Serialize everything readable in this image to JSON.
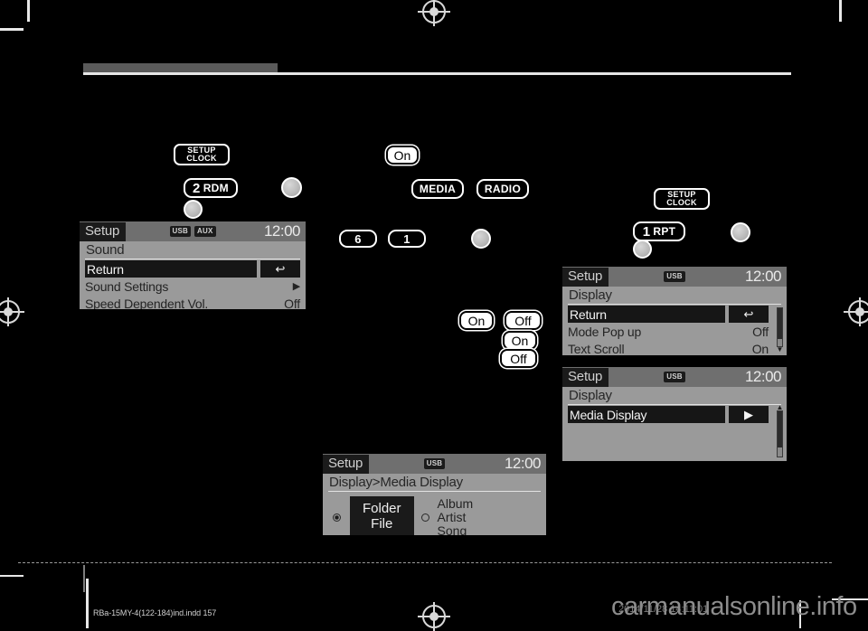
{
  "page": {
    "footer_file": "RBa-15MY-4(122-184)ind.indd   157",
    "watermark": "carmanualsonline.info",
    "watermark_time": "2014/11/28   14:11:01"
  },
  "keys": {
    "setup_clock_left": {
      "line1": "SETUP",
      "line2": "CLOCK"
    },
    "setup_clock_right": {
      "line1": "SETUP",
      "line2": "CLOCK"
    },
    "preset_2_rdm": {
      "digit": "2",
      "word": "RDM"
    },
    "preset_1_rpt": {
      "digit": "1",
      "word": "RPT"
    },
    "media": "MEDIA",
    "radio": "RADIO",
    "preset_6": "6",
    "preset_1": "1"
  },
  "softkeys": {
    "on_top": "On",
    "on_a": "On",
    "off_a": "Off",
    "on_b": "On",
    "off_b": "Off"
  },
  "screens": {
    "sound": {
      "title": "Setup",
      "badges": [
        "USB",
        "AUX"
      ],
      "clock": "12:00",
      "subtitle": "Sound",
      "rows": [
        {
          "label": "Return",
          "value": "↩",
          "selected": true,
          "kind": "chip"
        },
        {
          "label": "Sound Settings",
          "value": "▶",
          "selected": false,
          "kind": "arrow"
        },
        {
          "label": "Speed Dependent Vol.",
          "value": "Off",
          "selected": false,
          "kind": "text"
        }
      ]
    },
    "display_main": {
      "title": "Setup",
      "badges": [
        "USB"
      ],
      "clock": "12:00",
      "subtitle": "Display",
      "rows": [
        {
          "label": "Return",
          "value": "↩",
          "selected": true,
          "kind": "chip"
        },
        {
          "label": "Mode Pop up",
          "value": "Off",
          "selected": false,
          "kind": "text"
        },
        {
          "label": "Text Scroll",
          "value": "On",
          "selected": false,
          "kind": "text"
        }
      ]
    },
    "display_media": {
      "title": "Setup",
      "badges": [
        "USB"
      ],
      "clock": "12:00",
      "subtitle": "Display",
      "rows": [
        {
          "label": "Media Display",
          "value": "▶",
          "selected": true,
          "kind": "chip"
        }
      ]
    },
    "media_display": {
      "title": "Setup",
      "badges": [
        "USB"
      ],
      "clock": "12:00",
      "subtitle": "Display>Media Display",
      "option_selected": {
        "line1": "Folder",
        "line2": "File",
        "checked": true
      },
      "option_other": {
        "line1": "Album",
        "line2": "Artist",
        "line3": "Song",
        "checked": false
      }
    }
  }
}
